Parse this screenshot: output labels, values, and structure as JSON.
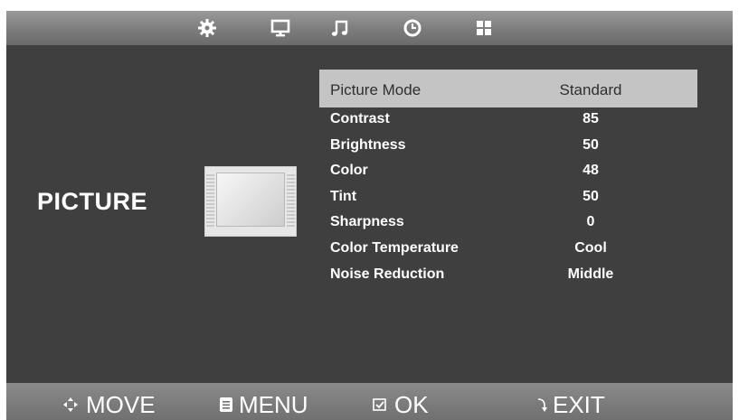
{
  "tabs": [
    {
      "icon": "gear-icon"
    },
    {
      "icon": "monitor-icon"
    },
    {
      "icon": "music-note-icon"
    },
    {
      "icon": "clock-icon"
    },
    {
      "icon": "grid-icon"
    }
  ],
  "section_title": "PICTURE",
  "menu": [
    {
      "label": "Picture Mode",
      "value": "Standard"
    },
    {
      "label": "Contrast",
      "value": "85"
    },
    {
      "label": "Brightness",
      "value": "50"
    },
    {
      "label": "Color",
      "value": "48"
    },
    {
      "label": "Tint",
      "value": "50"
    },
    {
      "label": "Sharpness",
      "value": "0"
    },
    {
      "label": "Color Temperature",
      "value": "Cool"
    },
    {
      "label": "Noise Reduction",
      "value": "Middle"
    }
  ],
  "footer": {
    "move": "MOVE",
    "menu": "MENU",
    "ok": "OK",
    "exit": "EXIT"
  },
  "colors": {
    "background": "#3f3f3f",
    "highlight": "#c4c4c4",
    "text": "#ffffff"
  }
}
